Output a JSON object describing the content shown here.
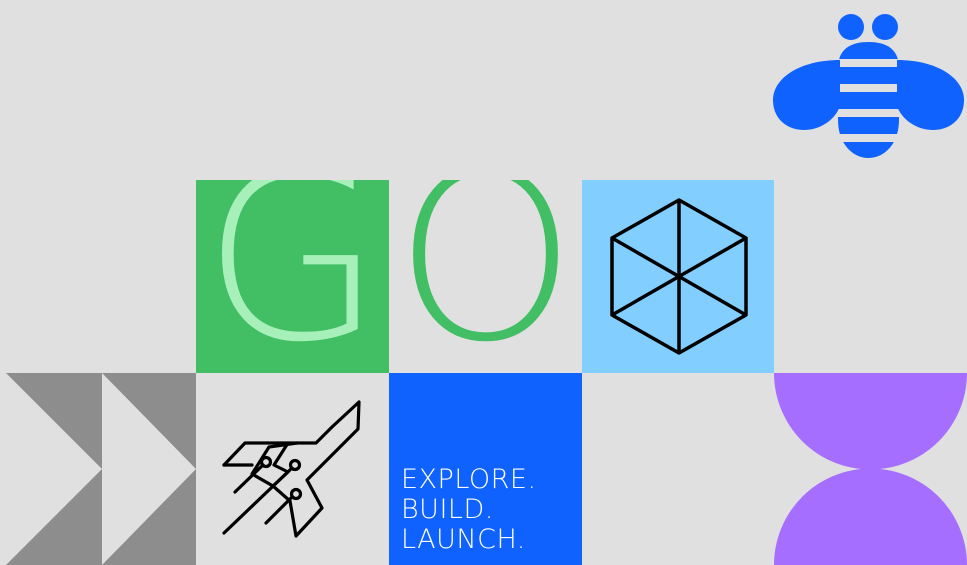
{
  "artwork": {
    "letters": {
      "first": "G",
      "second": "O"
    },
    "slogan": {
      "line1": "EXPLORE.",
      "line2": "BUILD.",
      "line3": "LAUNCH."
    },
    "icons": [
      "bee-icon",
      "hexagon-cube-icon",
      "rocket-icon",
      "fast-forward-chevrons-icon",
      "half-circles-icon"
    ],
    "colors": {
      "background": "#e0e0e0",
      "green": "#42be65",
      "light_green": "#a7f0ba",
      "light_blue": "#82cfff",
      "blue": "#0f62fe",
      "purple": "#a56eff",
      "gray": "#8d8d8d",
      "black": "#000000"
    }
  }
}
